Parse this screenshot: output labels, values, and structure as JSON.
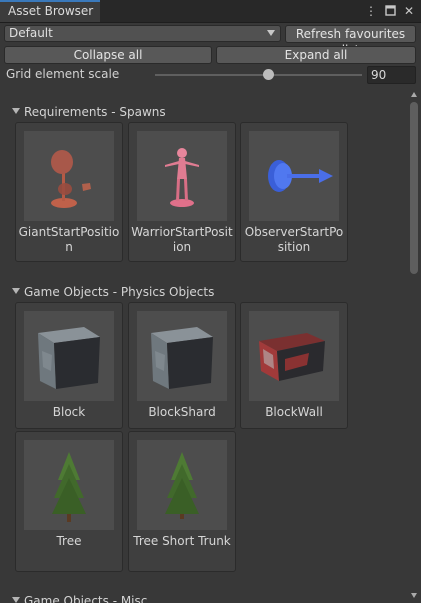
{
  "window": {
    "tab_title": "Asset Browser",
    "menu_icon": "kebab-menu-icon",
    "maximize_icon": "maximize-icon",
    "close_icon": "close-icon"
  },
  "toolbar": {
    "dropdown_value": "Default",
    "refresh_label": "Refresh favourites list",
    "collapse_label": "Collapse all",
    "expand_label": "Expand all",
    "scale_label": "Grid element scale",
    "scale_value": "90",
    "scale_fraction": 0.55
  },
  "sections": [
    {
      "title": "Requirements - Spawns",
      "items": [
        {
          "label": "GiantStartPosition",
          "icon": "giant-spawn-icon"
        },
        {
          "label": "WarriorStartPosition",
          "icon": "warrior-spawn-icon"
        },
        {
          "label": "ObserverStartPosition",
          "icon": "observer-spawn-icon"
        }
      ]
    },
    {
      "title": "Game Objects - Physics Objects",
      "items": [
        {
          "label": "Block",
          "icon": "stone-block-icon"
        },
        {
          "label": "BlockShard",
          "icon": "stone-block-icon"
        },
        {
          "label": "BlockWall",
          "icon": "wall-block-icon"
        },
        {
          "label": "Tree",
          "icon": "pine-tree-icon"
        },
        {
          "label": "Tree Short Trunk",
          "icon": "pine-tree-icon"
        }
      ]
    },
    {
      "title": "Game Objects - Misc",
      "items": []
    }
  ]
}
